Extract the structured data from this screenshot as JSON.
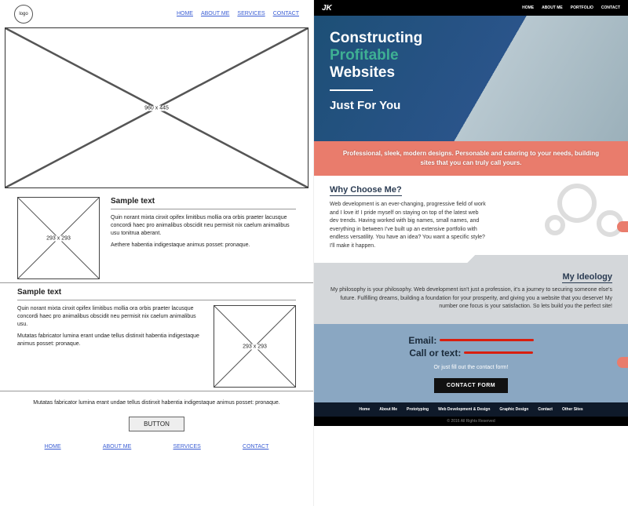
{
  "wireframe": {
    "logo_label": "logo",
    "nav": [
      "HOME",
      "ABOUT ME",
      "SERVICES",
      "CONTACT"
    ],
    "hero_placeholder": "960 x 445",
    "section1": {
      "heading": "Sample text",
      "para1": "Quin norant mixta cinxit opifex limitibus mollia ora orbis praeter lacusque concordi haec pro animalibus obscidit neu permisit nix caelum animalibus usu tonitrua aberant.",
      "para2": "Aethere habentia indigestaque animus posset: pronaque.",
      "ph_label": "293 x 293"
    },
    "section2": {
      "heading": "Sample text",
      "para1": "Quin norant mixta cinxit opifex limitibus mollia ora orbis praeter lacusque concordi haec pro animalibus obscidit neu permisit nix caelum animalibus usu.",
      "para2": "Mutatas fabricator lumina erant undae tellus distinxit habentia indigestaque animus posset: pronaque.",
      "ph_label": "293 x 293"
    },
    "footer_text": "Mutatas fabricator lumina erant undae tellus distinxit habentia indigestaque animus posset: pronaque.",
    "button_label": "BUTTON",
    "footer_nav": [
      "HOME",
      "ABOUT ME",
      "SERVICES",
      "CONTACT"
    ]
  },
  "portfolio": {
    "logo": "JK",
    "nav": [
      "HOME",
      "ABOUT ME",
      "PORTFOLIO",
      "CONTACT"
    ],
    "hero": {
      "line1": "Constructing",
      "line2_accent": "Profitable",
      "line3": "Websites",
      "sub": "Just For You"
    },
    "band": "Professional, sleek, modern designs. Personable and catering to your needs, building sites that you can truly call yours.",
    "why": {
      "heading": "Why Choose Me?",
      "body": "Web development is an ever-changing, progressive field of work and I love it! I pride myself on staying on top of the latest  web dev trends. Having worked with big names, small names, and everything in between I've built up an extensive portfolio with endless versatility. You have an idea? You want a specific style? I'll make it happen."
    },
    "ideology": {
      "heading": "My Ideology",
      "body": "My philosophy is your philosophy. Web development isn't just a profession, it's a journey to securing someone else's future. Fulfilling dreams, building a foundation for your prosperity, and giving you a website that you deserve! My number one focus is your satisfaction. So lets build you the perfect site!"
    },
    "contact": {
      "email_label": "Email:",
      "phone_label": "Call or text:",
      "sub": "Or just fill out the contact form!",
      "button": "CONTACT FORM"
    },
    "footer_nav": [
      "Home",
      "About Me",
      "Prototyping",
      "Web Development & Design",
      "Graphic Design",
      "Contact",
      "Other Sites"
    ],
    "copyright": "© 2016 All Rights Reserved"
  }
}
